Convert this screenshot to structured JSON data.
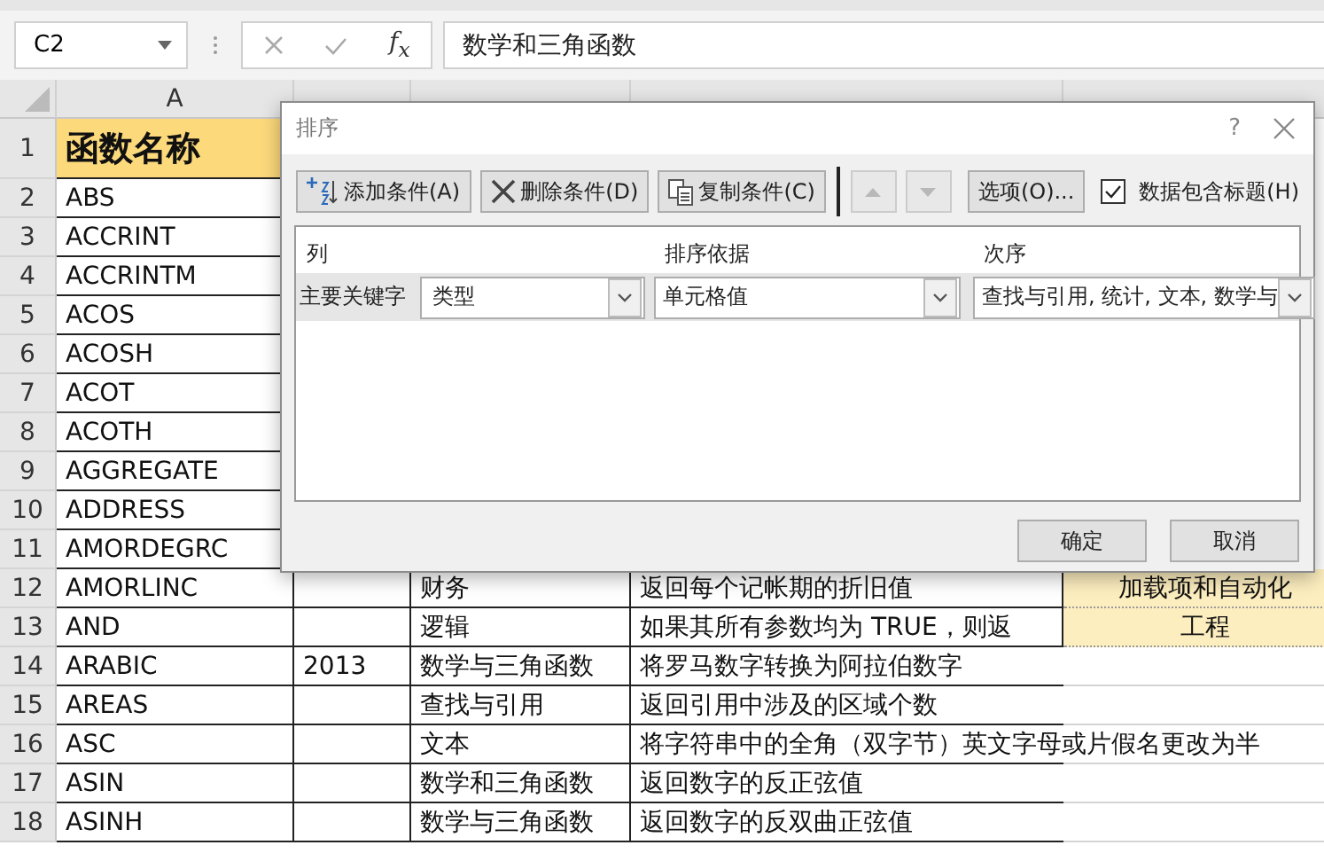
{
  "name_box": "C2",
  "formula_bar": {
    "function_label": "f$_{x}$",
    "value": "数学和三角函数"
  },
  "columns": [
    "A"
  ],
  "rows": [
    {
      "number": "1",
      "a": "函数名称",
      "header": true
    },
    {
      "number": "2",
      "a": "ABS"
    },
    {
      "number": "3",
      "a": "ACCRINT"
    },
    {
      "number": "4",
      "a": "ACCRINTM"
    },
    {
      "number": "5",
      "a": "ACOS"
    },
    {
      "number": "6",
      "a": "ACOSH"
    },
    {
      "number": "7",
      "a": "ACOT"
    },
    {
      "number": "8",
      "a": "ACOTH"
    },
    {
      "number": "9",
      "a": "AGGREGATE"
    },
    {
      "number": "10",
      "a": "ADDRESS"
    },
    {
      "number": "11",
      "a": "AMORDEGRC"
    },
    {
      "number": "12",
      "a": "AMORLINC",
      "c": "财务",
      "d": "返回每个记帐期的折旧值",
      "e": "加载项和自动化",
      "e_fill": true
    },
    {
      "number": "13",
      "a": "AND",
      "c": "逻辑",
      "d": "如果其所有参数均为 TRUE，则返",
      "e": "工程",
      "e_fill": true
    },
    {
      "number": "14",
      "a": "ARABIC",
      "b": "2013",
      "c": "数学与三角函数",
      "d": "将罗马数字转换为阿拉伯数字"
    },
    {
      "number": "15",
      "a": "AREAS",
      "c": "查找与引用",
      "d": "返回引用中涉及的区域个数"
    },
    {
      "number": "16",
      "a": "ASC",
      "c": "文本",
      "d": "将字符串中的全角（双字节）英文字母或片假名更改为半"
    },
    {
      "number": "17",
      "a": "ASIN",
      "c": "数学和三角函数",
      "d": "返回数字的反正弦值"
    },
    {
      "number": "18",
      "a": "ASINH",
      "c": "数学与三角函数",
      "d": "返回数字的反双曲正弦值"
    }
  ],
  "dialog": {
    "title": "排序",
    "help": "?",
    "toolbar": [
      {
        "kind": "add",
        "label": "添加条件(A)"
      },
      {
        "kind": "delete",
        "label": "删除条件(D)"
      },
      {
        "kind": "copy",
        "label": "复制条件(C)"
      },
      {
        "kind": "up",
        "disabled": true
      },
      {
        "kind": "down",
        "disabled": true
      },
      {
        "kind": "text",
        "label": "选项(O)..."
      }
    ],
    "has_headers": {
      "label": "数据包含标题(H)",
      "checked": true
    },
    "headings": [
      "列",
      "排序依据",
      "次序"
    ],
    "levels": [
      {
        "label": "主要关键字",
        "column": "类型",
        "sort_on": "单元格值",
        "order": "查找与引用, 统计, 文本, 数学与"
      }
    ],
    "buttons": [
      "确定",
      "取消"
    ]
  }
}
